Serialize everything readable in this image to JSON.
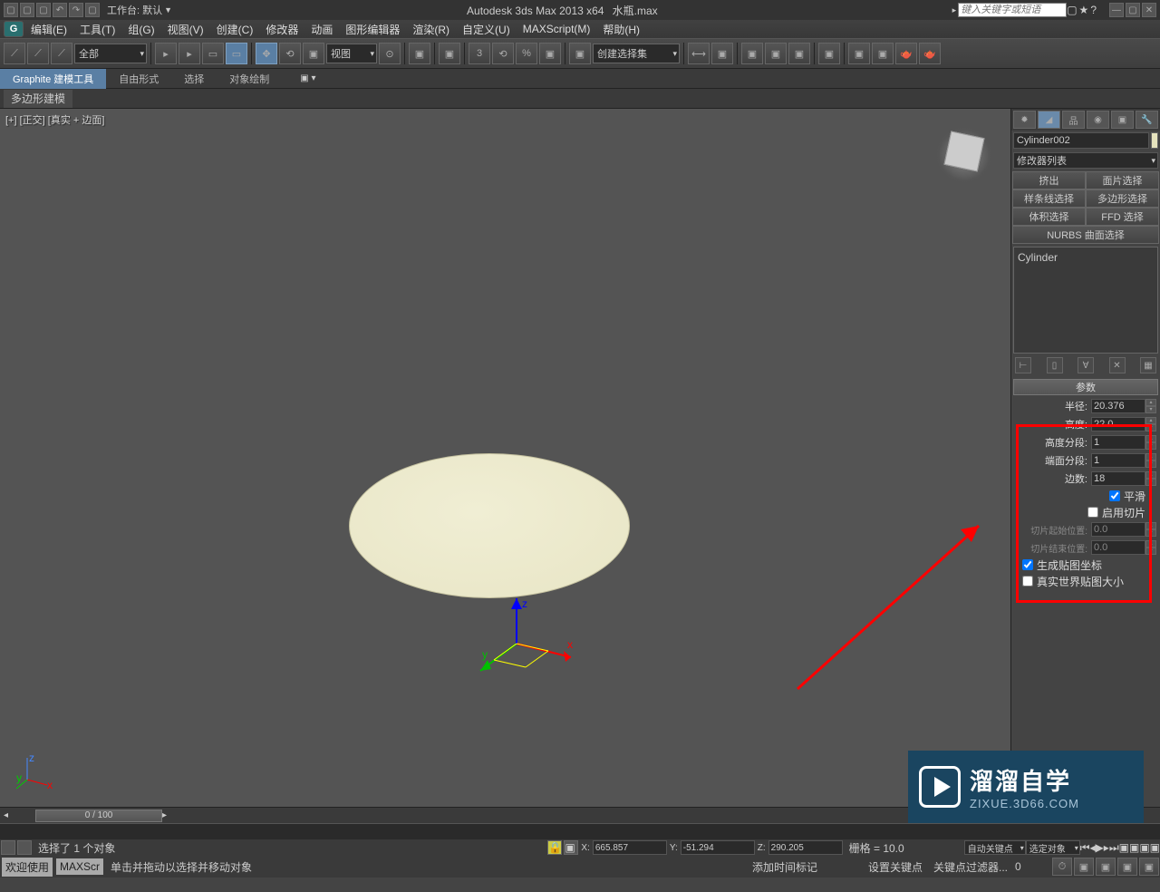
{
  "title": {
    "app": "Autodesk 3ds Max  2013 x64",
    "file": "水瓶.max",
    "workspace": "工作台: 默认",
    "search_ph": "键入关键字或短语"
  },
  "menu": [
    "编辑(E)",
    "工具(T)",
    "组(G)",
    "视图(V)",
    "创建(C)",
    "修改器",
    "动画",
    "图形编辑器",
    "渲染(R)",
    "自定义(U)",
    "MAXScript(M)",
    "帮助(H)"
  ],
  "toolbar": {
    "filter": "全部",
    "view": "视图",
    "selset": "创建选择集"
  },
  "ribbon": {
    "tabs": [
      "Graphite 建模工具",
      "自由形式",
      "选择",
      "对象绘制"
    ],
    "sub": "多边形建模"
  },
  "viewport": {
    "label": "[+] [正交] [真实 + 边面]"
  },
  "panel": {
    "objname": "Cylinder002",
    "modlist": "修改器列表",
    "setbtns": [
      "挤出",
      "面片选择",
      "样条线选择",
      "多边形选择",
      "体积选择",
      "FFD 选择",
      "NURBS 曲面选择"
    ],
    "stack": "Cylinder",
    "rollhead": "参数",
    "params": [
      {
        "lbl": "半径:",
        "val": "20.376"
      },
      {
        "lbl": "高度:",
        "val": "22.0"
      },
      {
        "lbl": "高度分段:",
        "val": "1"
      },
      {
        "lbl": "端面分段:",
        "val": "1"
      },
      {
        "lbl": "边数:",
        "val": "18"
      }
    ],
    "chk_smooth": "平滑",
    "chk_slice": "启用切片",
    "slice_from": {
      "lbl": "切片起始位置:",
      "val": "0.0"
    },
    "slice_to": {
      "lbl": "切片结束位置:",
      "val": "0.0"
    },
    "chk_mapcoord": "生成贴图坐标",
    "chk_realworld": "真实世界贴图大小"
  },
  "time": {
    "pos": "0 / 100"
  },
  "status": {
    "sel": "选择了 1 个对象",
    "x": "665.857",
    "y": "-51.294",
    "z": "290.205",
    "grid": "栅格 = 10.0",
    "autokey": "自动关键点",
    "selset": "选定对象",
    "setkey": "设置关键点",
    "keyfilter": "关键点过滤器...",
    "tags": [
      "欢迎使用",
      "MAXScr"
    ],
    "prompt": "单击并拖动以选择并移动对象",
    "addmarker": "添加时间标记"
  },
  "watermark": {
    "l1": "溜溜自学",
    "l2": "ZIXUE.3D66.COM"
  }
}
